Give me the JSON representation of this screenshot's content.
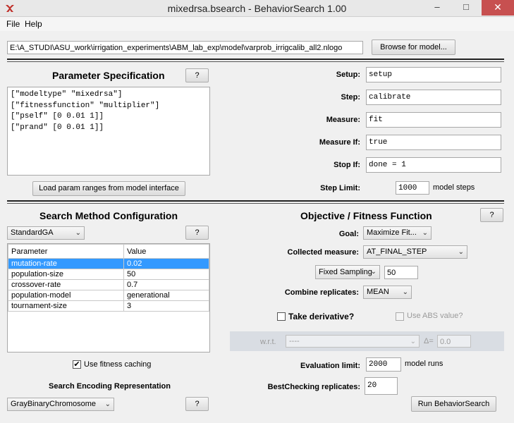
{
  "window": {
    "title": "mixedrsa.bsearch - BehaviorSearch 1.00",
    "minimize": "–",
    "maximize": "□",
    "close": "✕"
  },
  "menu": {
    "file": "File",
    "help": "Help"
  },
  "model": {
    "path": "E:\\A_STUDI\\ASU_work\\irrigation_experiments\\ABM_lab_exp\\model\\varprob_irrigcalib_all2.nlogo",
    "browse_label": "Browse for model..."
  },
  "param_spec": {
    "title": "Parameter Specification",
    "help": "?",
    "lines": [
      "[\"modeltype\" \"mixedrsa\"]",
      "[\"fitnessfunction\" \"multiplier\"]",
      "[\"pself\" [0 0.01 1]]",
      "[\"prand\" [0 0.01 1]]"
    ],
    "load_label": "Load param ranges from model interface"
  },
  "commands": {
    "setup_label": "Setup:",
    "setup": "setup",
    "step_label": "Step:",
    "step": "calibrate",
    "measure_label": "Measure:",
    "measure": "fit",
    "measure_if_label": "Measure If:",
    "measure_if": "true",
    "stop_if_label": "Stop If:",
    "stop_if": "done = 1",
    "step_limit_label": "Step Limit:",
    "step_limit": "1000",
    "step_limit_unit": "model steps"
  },
  "search": {
    "title": "Search Method Configuration",
    "method": "StandardGA",
    "help": "?",
    "columns": [
      "Parameter",
      "Value"
    ],
    "rows": [
      {
        "param": "mutation-rate",
        "value": "0.02"
      },
      {
        "param": "population-size",
        "value": "50"
      },
      {
        "param": "crossover-rate",
        "value": "0.7"
      },
      {
        "param": "population-model",
        "value": "generational"
      },
      {
        "param": "tournament-size",
        "value": "3"
      }
    ],
    "fitness_caching_label": "Use fitness caching",
    "fitness_caching_checked": "✔",
    "encoding_title": "Search Encoding Representation",
    "encoding": "GrayBinaryChromosome",
    "encoding_help": "?"
  },
  "objective": {
    "title": "Objective / Fitness Function",
    "help": "?",
    "goal_label": "Goal:",
    "goal": "Maximize Fit...",
    "collected_label": "Collected measure:",
    "collected": "AT_FINAL_STEP",
    "sampling": "Fixed Sampling",
    "sampling_count": "50",
    "combine_label": "Combine replicates:",
    "combine": "MEAN",
    "derivative_label": "Take derivative?",
    "abs_label": "Use ABS value?",
    "wrt_label": "w.r.t.",
    "wrt": "----",
    "delta_label": "Δ=",
    "delta": "0.0",
    "eval_label": "Evaluation limit:",
    "eval": "2000",
    "eval_unit": "model runs",
    "best_label": "BestChecking replicates:",
    "best": "20",
    "run_label": "Run BehaviorSearch"
  }
}
